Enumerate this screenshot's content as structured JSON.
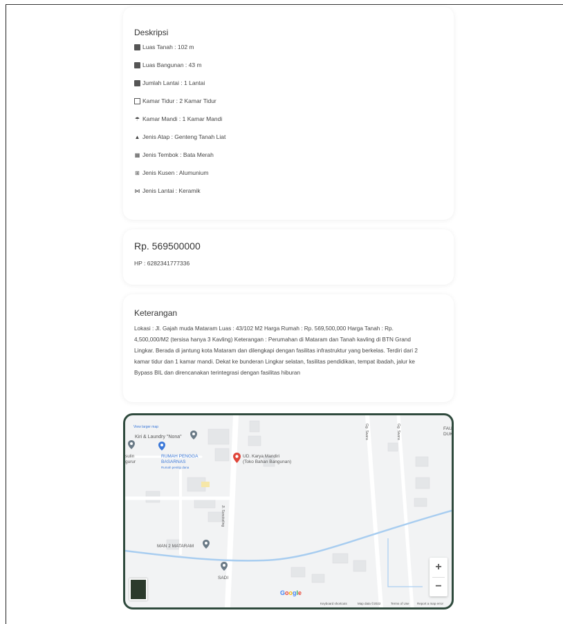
{
  "description": {
    "title": "Deskripsi",
    "features": [
      {
        "icon": "land-area-icon",
        "label": "Luas Tanah : 102 m"
      },
      {
        "icon": "building-area-icon",
        "label": "Luas Bangunan : 43 m"
      },
      {
        "icon": "floors-icon",
        "label": "Jumlah Lantai : 1 Lantai"
      },
      {
        "icon": "bedroom-icon",
        "label": "Kamar Tidur : 2 Kamar Tidur"
      },
      {
        "icon": "bathroom-icon",
        "label": "Kamar Mandi : 1 Kamar Mandi"
      },
      {
        "icon": "roof-icon",
        "label": "Jenis Atap : Genteng Tanah Liat"
      },
      {
        "icon": "wall-icon",
        "label": "Jenis Tembok : Bata Merah"
      },
      {
        "icon": "window-frame-icon",
        "label": "Jenis Kusen : Alumunium"
      },
      {
        "icon": "floor-icon",
        "label": "Jenis Lantai : Keramik"
      }
    ]
  },
  "price_card": {
    "price": "Rp. 569500000",
    "phone": "HP : 6282341777336"
  },
  "info_card": {
    "title": "Keterangan",
    "text": "Lokasi : Jl. Gajah muda Mataram Luas : 43/102 M2 Harga Rumah : Rp. 569,500,000 Harga Tanah : Rp. 4,500,000/M2 (tersisa hanya 3 Kavling) Keterangan : Perumahan di Mataram dan Tanah kavling di BTN Grand Lingkar. Berada di jantung kota Mataram dan dilengkapi dengan fasilitas infrastruktur yang berkelas. Terdiri dari 2 kamar tidur dan 1 kamar mandi. Dekat ke bunderan Lingkar selatan, fasilitas pendidikan, tempat ibadah, jalur ke Bypass BIL dan direncanakan terintegrasi dengan fasilitas hiburan"
  },
  "map": {
    "view_larger": "View larger map",
    "places": {
      "laundry": "Kiri & Laundry \"Nona\"",
      "rumah_line1": "RUMAH PENGGA",
      "rumah_line2": "BASARNAS",
      "rumah_sub": "Rumah penitip dana",
      "store_line1": "UD. Karya Mandiri",
      "store_line2": "(Toko Bahan Bangunan)",
      "school": "MAN 2 MATARAM",
      "left_edge1": "sulin",
      "left_edge2": "gurur",
      "bottom_label": "SADI",
      "right_top1": "FAU",
      "right_top2": "DUK"
    },
    "streets": {
      "main": "Jl. Sonokeling",
      "right1": "Gg. Swara",
      "right2": "Gg. Swara"
    },
    "zoom_in": "+",
    "zoom_out": "−",
    "logo": "Google",
    "footer": {
      "shortcuts": "Keyboard shortcuts",
      "data": "Map data ©2022",
      "terms": "Terms of Use",
      "report": "Report a map error"
    },
    "colors": {
      "border": "#2f4a3d",
      "water": "#a8cdf0",
      "pin_red": "#e0463a",
      "pin_gray": "#6a7a86",
      "pin_blue": "#3b78d8"
    }
  }
}
